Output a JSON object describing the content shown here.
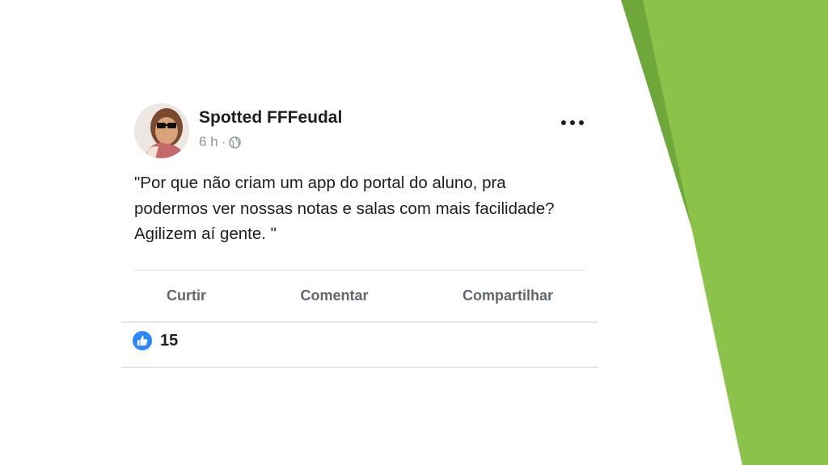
{
  "post": {
    "author": "Spotted FFFeudal",
    "time": "6 h",
    "separator": "·",
    "privacy_icon": "globe-icon",
    "more_icon": "more-options-icon",
    "text": "\"Por que não criam um app do portal do aluno, pra podermos ver nossas notas e salas com mais facilidade? Agilizem aí gente. \""
  },
  "actions": {
    "like_label": "Curtir",
    "comment_label": "Comentar",
    "share_label": "Compartilhar"
  },
  "reactions": {
    "icon": "like-icon",
    "count": "15"
  },
  "colors": {
    "accent_green": "#8bc34a",
    "accent_green_dark": "#6ea83a",
    "like_blue": "#2d88ff"
  }
}
